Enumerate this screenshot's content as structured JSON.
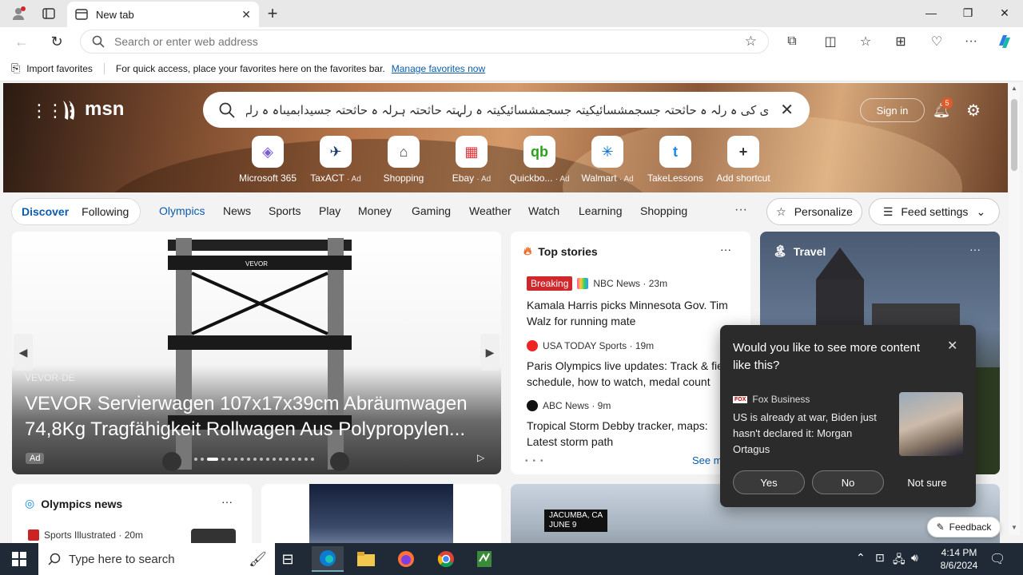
{
  "browser": {
    "tab_title": "New tab",
    "address_placeholder": "Search or enter web address",
    "window_controls": {
      "minimize": "—",
      "maximize": "❐",
      "close": "✕"
    }
  },
  "favorites_bar": {
    "import_label": "Import favorites",
    "hint_text": "For quick access, place your favorites here on the favorites bar.",
    "manage_link": "Manage favorites now"
  },
  "msn": {
    "logo_text": "msn",
    "search_query": "ی کی ہ رلہ ہ حاثحتہ جسجمشسائیکیتہ جسجمشسائیکیتہ ہ رلہتہ حاثحتہ ہرلہ ہ حاثحتہ جسیدابمیںاہ ہ رلہتہ ہ",
    "sign_in": "Sign in",
    "notification_count": "5",
    "shortcuts": [
      {
        "label": "Microsoft 365",
        "ad": "",
        "icon": "microsoft-365-icon",
        "glyph": "◈",
        "color": "#7b5cd6"
      },
      {
        "label": "TaxACT",
        "ad": "· Ad",
        "icon": "taxact-icon",
        "glyph": "✈",
        "color": "#1b3a6b"
      },
      {
        "label": "Shopping",
        "ad": "",
        "icon": "shopping-tag-icon",
        "glyph": "⌂",
        "color": "#444444"
      },
      {
        "label": "Ebay",
        "ad": "· Ad",
        "icon": "ebay-bag-icon",
        "glyph": "▦",
        "color": "#e53238"
      },
      {
        "label": "Quickbo...",
        "ad": "· Ad",
        "icon": "quickbooks-icon",
        "glyph": "qb",
        "color": "#2ca01c"
      },
      {
        "label": "Walmart",
        "ad": "· Ad",
        "icon": "walmart-icon",
        "glyph": "✳",
        "color": "#0071ce"
      },
      {
        "label": "TakeLessons",
        "ad": "",
        "icon": "takelessons-icon",
        "glyph": "t",
        "color": "#1e88e5"
      },
      {
        "label": "Add shortcut",
        "ad": "",
        "icon": "plus-icon",
        "glyph": "+",
        "color": "#333333"
      }
    ]
  },
  "feed_nav": {
    "discover": "Discover",
    "following": "Following",
    "categories": [
      "Olympics",
      "News",
      "Sports",
      "Play",
      "Money",
      "Gaming",
      "Weather",
      "Watch",
      "Learning",
      "Shopping"
    ],
    "more": "···",
    "personalize": "Personalize",
    "feed_settings": "Feed settings"
  },
  "hero": {
    "brand": "VEVOR-DE",
    "headline": "VEVOR Servierwagen 107x17x39cm Abräumwagen 74,8Kg Tragfähigkeit Rollwagen Aus Polypropylen...",
    "ad_label": "Ad",
    "product_label": "VEVOR"
  },
  "top_stories": {
    "header": "Top stories",
    "more": "···",
    "stories": [
      {
        "badge": "Breaking",
        "source": "NBC News · 23m",
        "title": "Kamala Harris picks Minnesota Gov. Tim Walz for running mate"
      },
      {
        "badge": "",
        "source": "USA TODAY Sports · 19m",
        "title": "Paris Olympics live updates: Track & field schedule, how to watch, medal count"
      },
      {
        "badge": "",
        "source": "ABC News · 9m",
        "title": "Tropical Storm Debby tracker, maps: Latest storm path"
      }
    ],
    "see_more": "See more"
  },
  "travel": {
    "header": "Travel",
    "more": "···"
  },
  "popup": {
    "question": "Would you like to see more content like this?",
    "source": "Fox Business",
    "source_badge": "FOX",
    "title": "US is already at war, Biden just hasn't declared it: Morgan Ortagus",
    "yes": "Yes",
    "no": "No",
    "not_sure": "Not sure"
  },
  "olympics_card": {
    "header": "Olympics news",
    "more": "···",
    "source": "Sports Illustrated · 20m"
  },
  "video_card": {
    "location": "JACUMBA, CA",
    "date": "JUNE 9"
  },
  "feedback": "Feedback",
  "taskbar": {
    "search_placeholder": "Type here to search",
    "time": "4:14 PM",
    "date": "8/6/2024"
  }
}
